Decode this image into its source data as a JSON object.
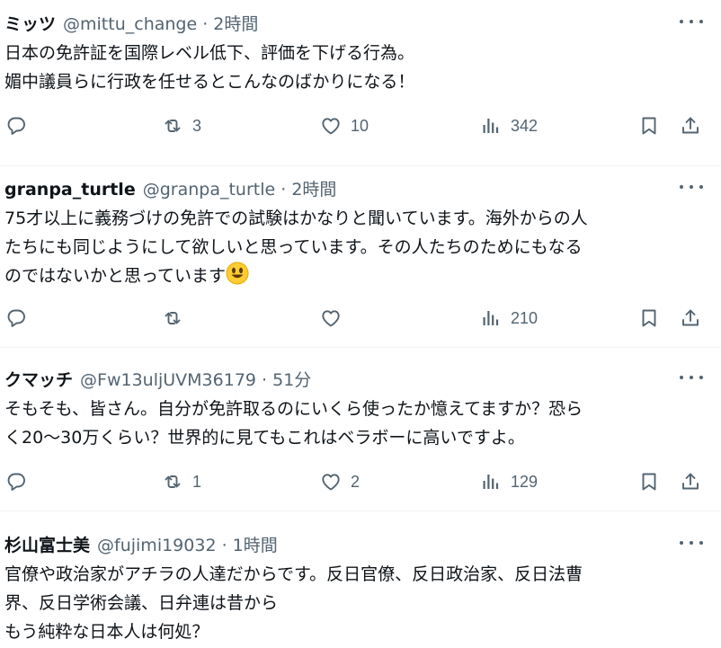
{
  "posts": [
    {
      "name": "ミッツ",
      "handle": "@mittu_change",
      "time": "2時間",
      "lines": [
        "日本の免許証を国際レベル低下、評価を下げる行為。",
        "媚中議員らに行政を任せるとこんなのばかりになる！"
      ],
      "replies": "",
      "reposts": "3",
      "likes": "10",
      "views": "342"
    },
    {
      "name": "granpa_turtle",
      "handle": "@granpa_turtle",
      "time": "2時間",
      "lines": [
        "75才以上に義務づけの免許での試験はかなりと聞いています。海外からの人",
        "たちにも同じようにして欲しいと思っています。その人たちのためにもなる",
        "のではないかと思っています"
      ],
      "emoji": "smiling-face",
      "replies": "",
      "reposts": "",
      "likes": "",
      "views": "210"
    },
    {
      "name": "クマッチ",
      "handle": "@Fw13uljUVM36179",
      "time": "51分",
      "lines": [
        "そもそも、皆さん。自分が免許取るのにいくら使ったか憶えてますか？恐ら",
        "く20～30万くらい？世界的に見てもこれはベラボーに高いですよ。"
      ],
      "replies": "",
      "reposts": "1",
      "likes": "2",
      "views": "129"
    },
    {
      "name": "杉山富士美",
      "handle": "@fujimi19032",
      "time": "1時間",
      "lines": [
        "官僚や政治家がアチラの人達だからです。反日官僚、反日政治家、反日法曹",
        "界、反日学術会議、日弁連は昔から",
        "もう純粋な日本人は何処？"
      ]
    }
  ],
  "separator": " · ",
  "icons": {
    "reply": "reply-icon",
    "repost": "repost-icon",
    "like": "heart-icon",
    "views": "views-icon",
    "bookmark": "bookmark-icon",
    "share": "share-icon",
    "more": "more-icon"
  },
  "colors": {
    "text": "#0f1419",
    "muted": "#536471",
    "divider": "#eff3f4"
  }
}
